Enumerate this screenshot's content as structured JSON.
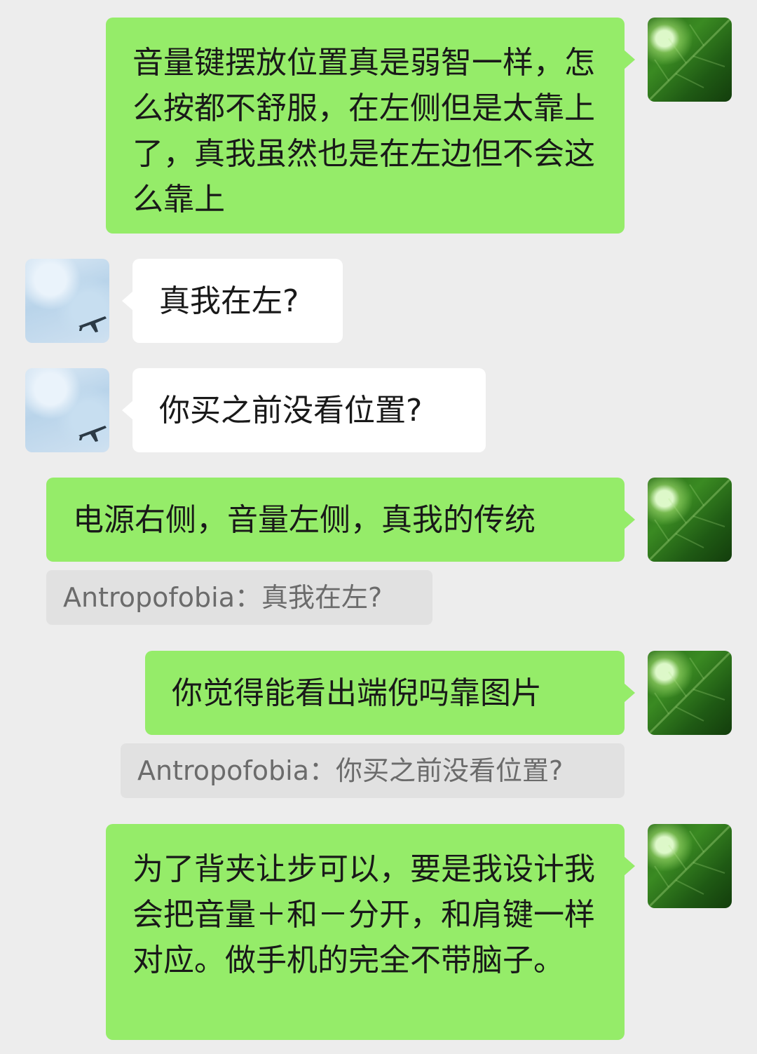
{
  "messages": [
    {
      "side": "me",
      "text": "音量键摆放位置真是弱智一样，怎么按都不舒服，在左侧但是太靠上了，真我虽然也是在左边但不会这么靠上"
    },
    {
      "side": "them",
      "text": "真我在左?"
    },
    {
      "side": "them",
      "text": "你买之前没看位置?"
    },
    {
      "side": "me",
      "text": "电源右侧，音量左侧，真我的传统",
      "quote": "Antropofobia：真我在左?"
    },
    {
      "side": "me",
      "text": "你觉得能看出端倪吗靠图片",
      "quote": "Antropofobia：你买之前没看位置?"
    },
    {
      "side": "me",
      "text": "为了背夹让步可以，要是我设计我会把音量＋和－分开，和肩键一样对应。做手机的完全不带脑子。"
    }
  ],
  "colors": {
    "background": "#ededed",
    "me_bubble": "#95ec69",
    "them_bubble": "#ffffff",
    "quote_bg": "#e1e1e1"
  }
}
